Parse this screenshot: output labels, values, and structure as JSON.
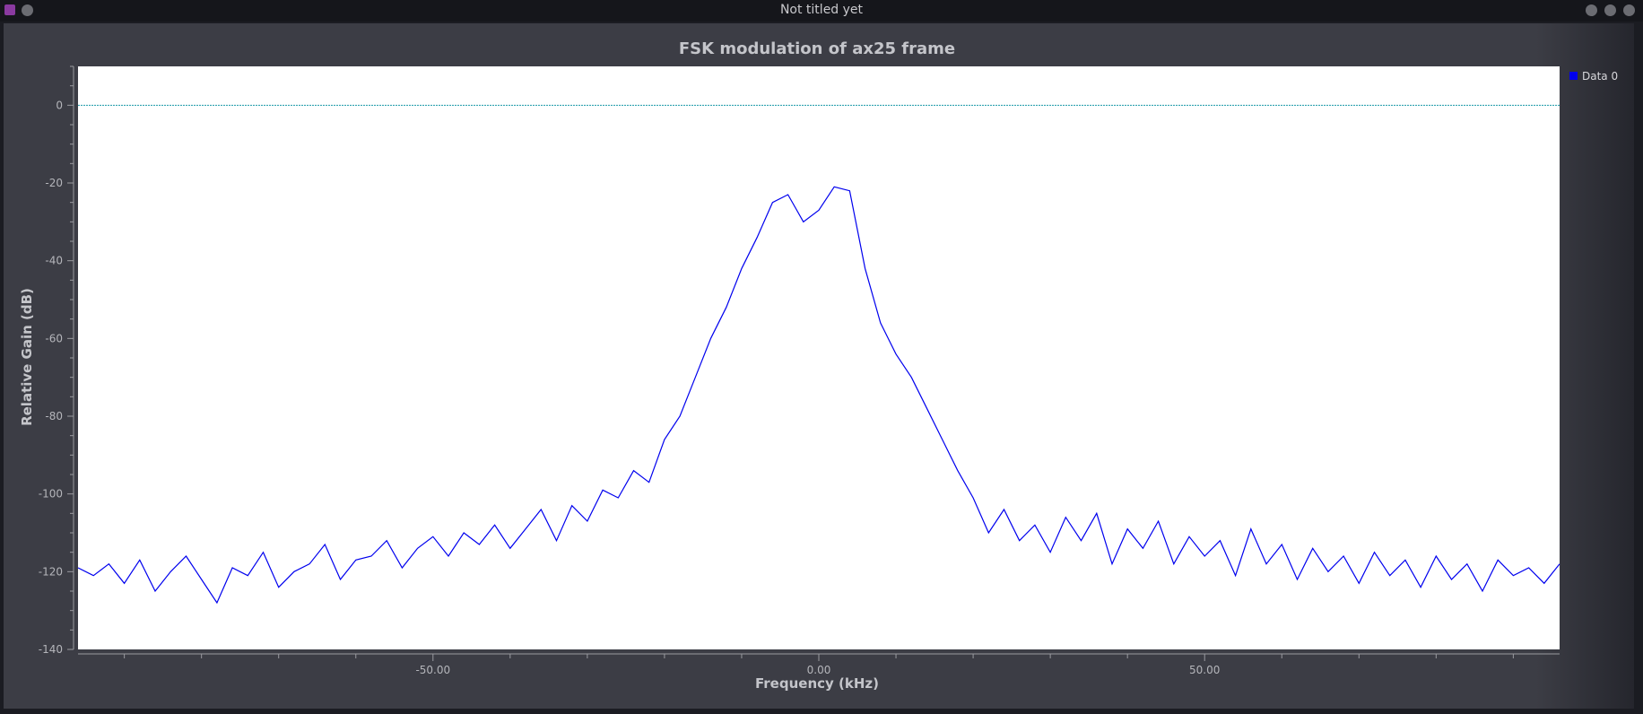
{
  "window": {
    "title": "Not titled yet"
  },
  "chart_data": {
    "type": "line",
    "title": "FSK modulation of ax25 frame",
    "xlabel": "Frequency (kHz)",
    "ylabel": "Relative Gain (dB)",
    "xlim": [
      -96.0,
      96.0
    ],
    "ylim": [
      -140,
      10
    ],
    "x_ticks": [
      -50,
      0,
      50
    ],
    "x_tick_labels": [
      "-50.00",
      "0.00",
      "50.00"
    ],
    "y_ticks": [
      0,
      -20,
      -40,
      -60,
      -80,
      -100,
      -120,
      -140
    ],
    "y_tick_labels": [
      "0",
      "-20",
      "-40",
      "-60",
      "-80",
      "-100",
      "-120",
      "-140"
    ],
    "reference_line": {
      "y": 0,
      "color": "#1a9aa8"
    },
    "grid": false,
    "legend": {
      "placement": "right-top"
    },
    "series": [
      {
        "name": "Data 0",
        "color": "#0000ee",
        "x": [
          -96,
          -94,
          -92,
          -90,
          -88,
          -86,
          -84,
          -82,
          -80,
          -78,
          -76,
          -74,
          -72,
          -70,
          -68,
          -66,
          -64,
          -62,
          -60,
          -58,
          -56,
          -54,
          -52,
          -50,
          -48,
          -46,
          -44,
          -42,
          -40,
          -38,
          -36,
          -34,
          -32,
          -30,
          -28,
          -26,
          -24,
          -22,
          -20,
          -18,
          -16,
          -14,
          -12,
          -10,
          -8,
          -6,
          -4,
          -2,
          0,
          2,
          4,
          6,
          8,
          10,
          12,
          14,
          16,
          18,
          20,
          22,
          24,
          26,
          28,
          30,
          32,
          34,
          36,
          38,
          40,
          42,
          44,
          46,
          48,
          50,
          52,
          54,
          56,
          58,
          60,
          62,
          64,
          66,
          68,
          70,
          72,
          74,
          76,
          78,
          80,
          82,
          84,
          86,
          88,
          90,
          92,
          94,
          96
        ],
        "values": [
          -119,
          -121,
          -118,
          -123,
          -117,
          -125,
          -120,
          -116,
          -122,
          -128,
          -119,
          -121,
          -115,
          -124,
          -120,
          -118,
          -113,
          -122,
          -117,
          -116,
          -112,
          -119,
          -114,
          -111,
          -116,
          -110,
          -113,
          -108,
          -114,
          -109,
          -104,
          -112,
          -103,
          -107,
          -99,
          -101,
          -94,
          -97,
          -86,
          -80,
          -70,
          -60,
          -52,
          -42,
          -34,
          -25,
          -23,
          -30,
          -27,
          -21,
          -22,
          -42,
          -56,
          -64,
          -70,
          -78,
          -86,
          -94,
          -101,
          -110,
          -104,
          -112,
          -108,
          -115,
          -106,
          -112,
          -105,
          -118,
          -109,
          -114,
          -107,
          -118,
          -111,
          -116,
          -112,
          -121,
          -109,
          -118,
          -113,
          -122,
          -114,
          -120,
          -116,
          -123,
          -115,
          -121,
          -117,
          -124,
          -116,
          -122,
          -118,
          -125,
          -117,
          -121,
          -119,
          -123,
          -118
        ]
      }
    ]
  }
}
